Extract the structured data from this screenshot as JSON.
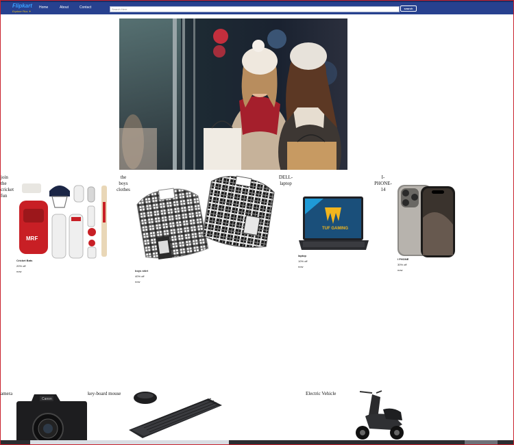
{
  "brand": {
    "name": "Flipkart",
    "tagline": "Explore",
    "tagline_plus": "Plus",
    "plus_symbol": "✦"
  },
  "nav": {
    "links": [
      "Home",
      "About",
      "Contact"
    ]
  },
  "search": {
    "placeholder": "Search Here",
    "button_label": "search"
  },
  "products_row1": [
    {
      "category": [
        "join",
        "the",
        "cricket",
        "fun"
      ],
      "name": "Cricket Bats",
      "discount": "20% off",
      "cta": "now"
    },
    {
      "category": [
        "the",
        "boys",
        "clothes"
      ],
      "name": "boys shirt",
      "discount": "40% off",
      "cta": "now"
    },
    {
      "category": [
        "DELL-",
        "laptop"
      ],
      "name": "laptop",
      "discount": "10% off",
      "cta": "now"
    },
    {
      "category": [
        "I-",
        "PHONE-",
        "14"
      ],
      "name": "I PHONE",
      "discount": "30% off",
      "cta": "now"
    }
  ],
  "products_row2": [
    {
      "category": "amera"
    },
    {
      "category": "key-board mouse"
    },
    {
      "category": "Electric Vehicle"
    }
  ],
  "colors": {
    "nav_bg": "#27418f",
    "logo_blue": "#3aa1ff",
    "logo_yellow": "#f0c419",
    "frame_red": "#c8202b"
  },
  "icons": [
    "hero-image",
    "cricket-kit-image",
    "shirts-image",
    "laptop-image",
    "phone-image",
    "camera-image",
    "keyboard-mouse-image",
    "scooter-image"
  ]
}
